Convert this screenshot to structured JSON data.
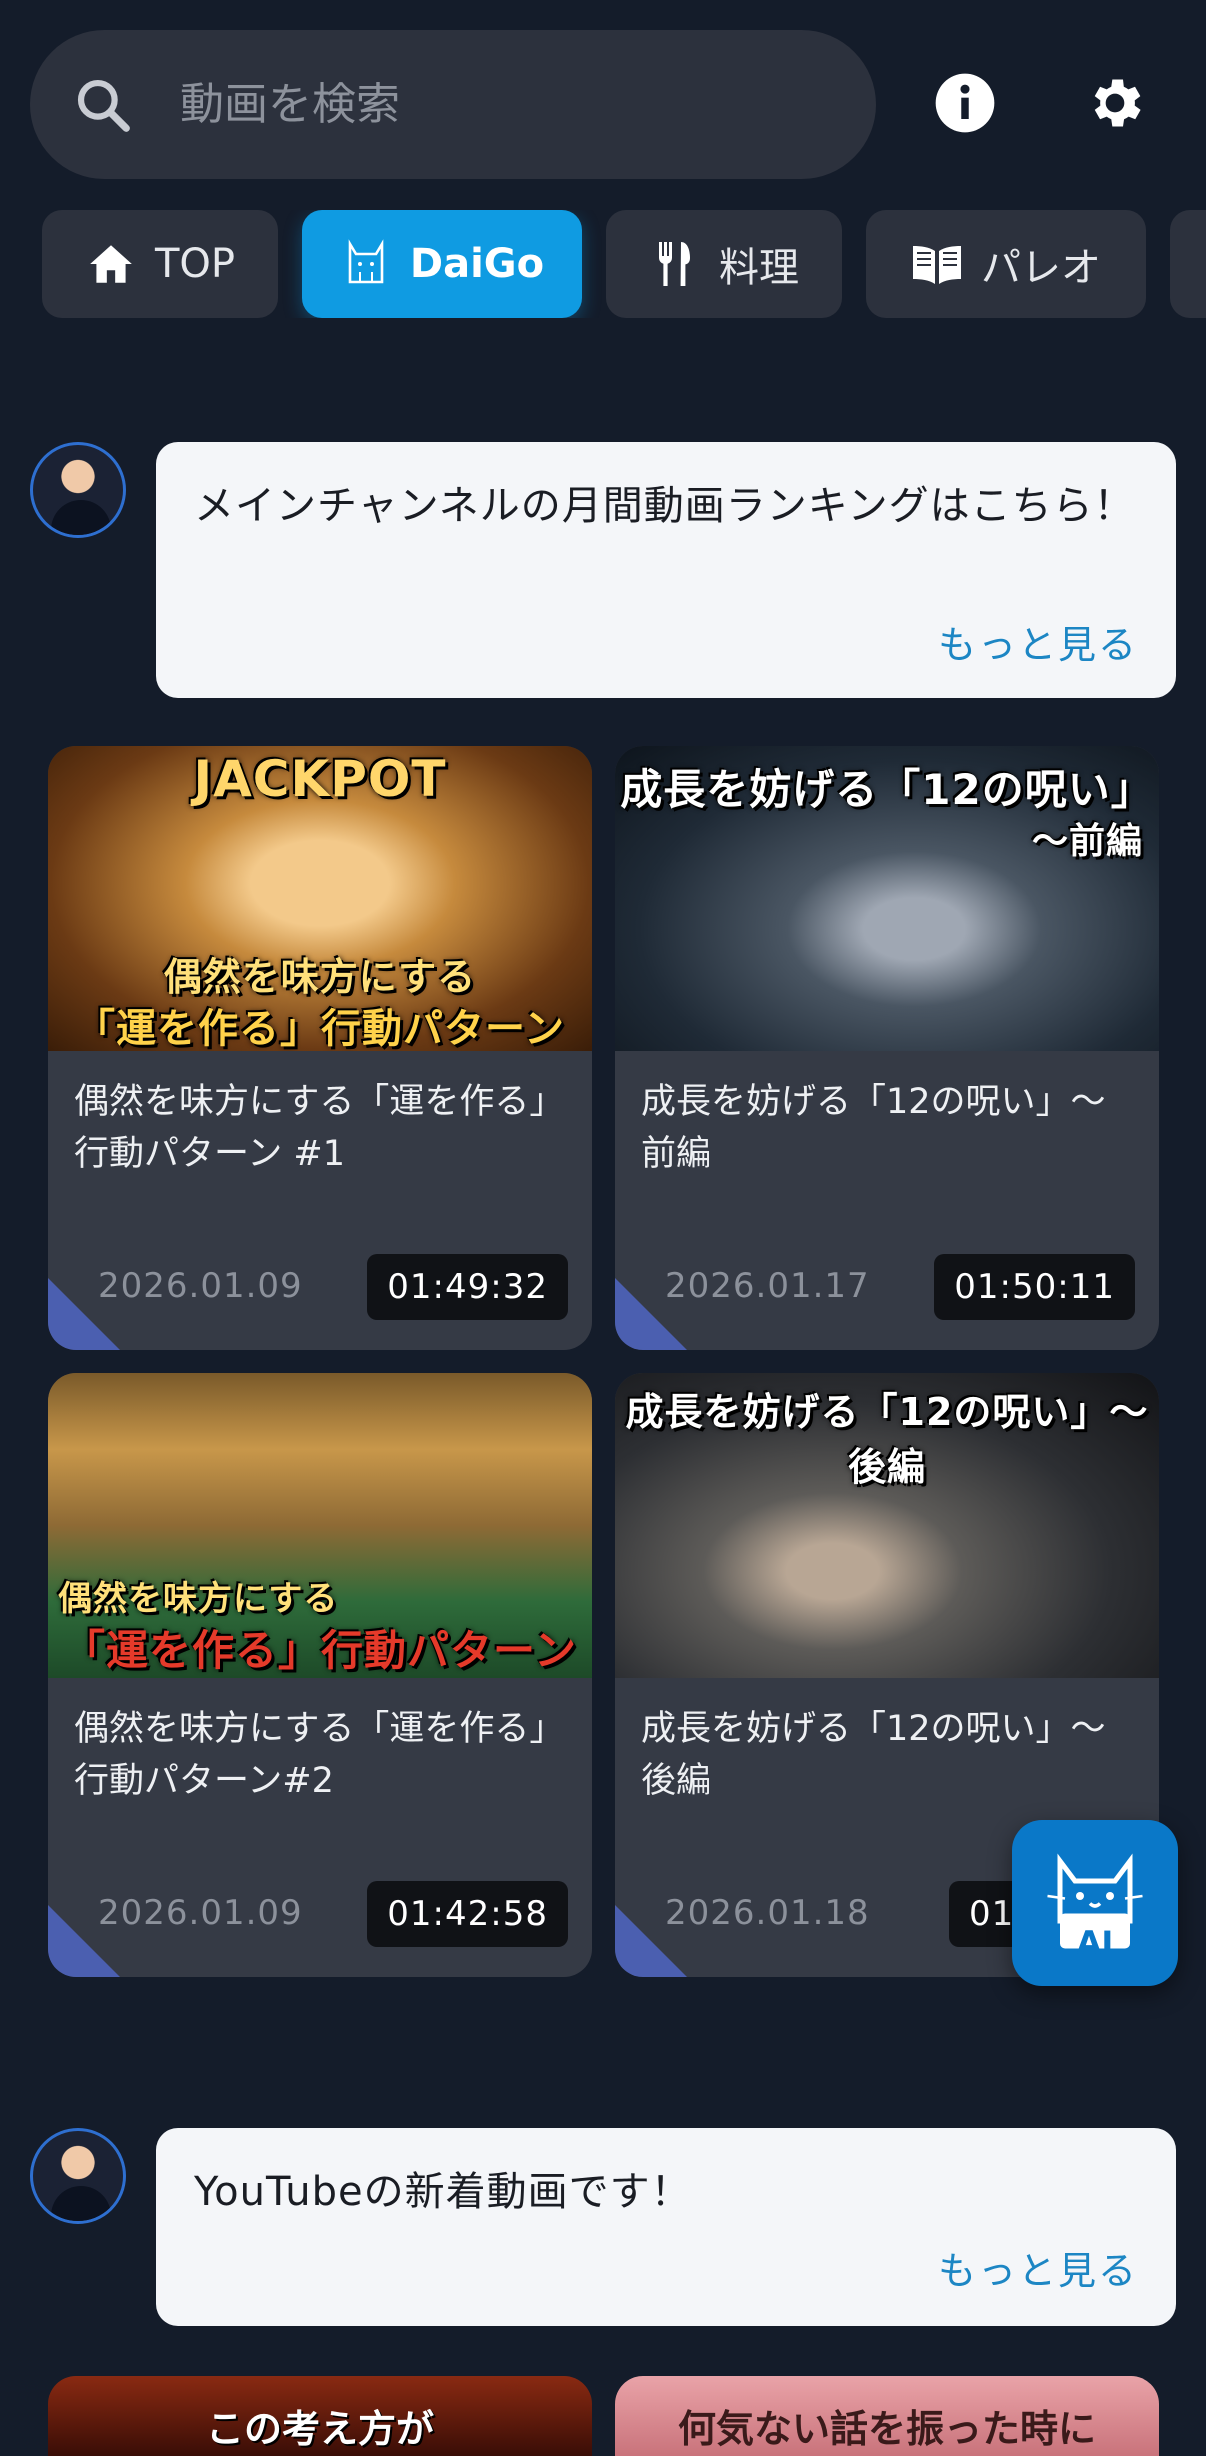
{
  "search": {
    "placeholder": "動画を検索",
    "icon": "search-icon"
  },
  "header": {
    "info_icon": "info-icon",
    "settings_icon": "gear-icon"
  },
  "tabs": [
    {
      "label": "TOP",
      "icon": "home-icon",
      "active": false
    },
    {
      "label": "DaiGo",
      "icon": "cat-icon",
      "active": true
    },
    {
      "label": "料理",
      "icon": "fork-knife-icon",
      "active": false
    },
    {
      "label": "パレオ",
      "icon": "book-icon",
      "active": false
    }
  ],
  "sections": [
    {
      "message": "メインチャンネルの月間動画ランキングはこちら！",
      "more": "もっと見る",
      "videos": [
        {
          "thumb_top": "JACKPOT",
          "thumb_caption_1": "偶然を味方にする",
          "thumb_caption_2": "「運を作る」行動パターン #1",
          "title": "偶然を味方にする「運を作る」行動パターン #1",
          "date": "2026.01.09",
          "duration": "01:49:32"
        },
        {
          "thumb_top": "成長を妨げる「12の呪い」",
          "thumb_caption_1": "〜前編",
          "title": "成長を妨げる「12の呪い」〜前編",
          "date": "2026.01.17",
          "duration": "01:50:11"
        },
        {
          "thumb_caption_1": "偶然を味方にする",
          "thumb_caption_2": "「運を作る」行動パターン#2",
          "title": "偶然を味方にする「運を作る」行動パターン#2",
          "date": "2026.01.09",
          "duration": "01:42:58"
        },
        {
          "thumb_top": "成長を妨げる「12の呪い」〜後編",
          "title": "成長を妨げる「12の呪い」〜後編",
          "date": "2026.01.18",
          "duration": "01"
        }
      ]
    },
    {
      "message": "YouTubeの新着動画です！",
      "more": "もっと見る",
      "videos": [
        {
          "thumb_caption_1": "この考え方が"
        },
        {
          "thumb_caption_1": "何気ない話を振った時に"
        }
      ]
    }
  ],
  "fab": {
    "label": "AI",
    "icon": "ai-cat-icon"
  },
  "colors": {
    "background": "#141c2a",
    "accent": "#0f9be2",
    "card": "#353a45",
    "link": "#1c86c4"
  }
}
